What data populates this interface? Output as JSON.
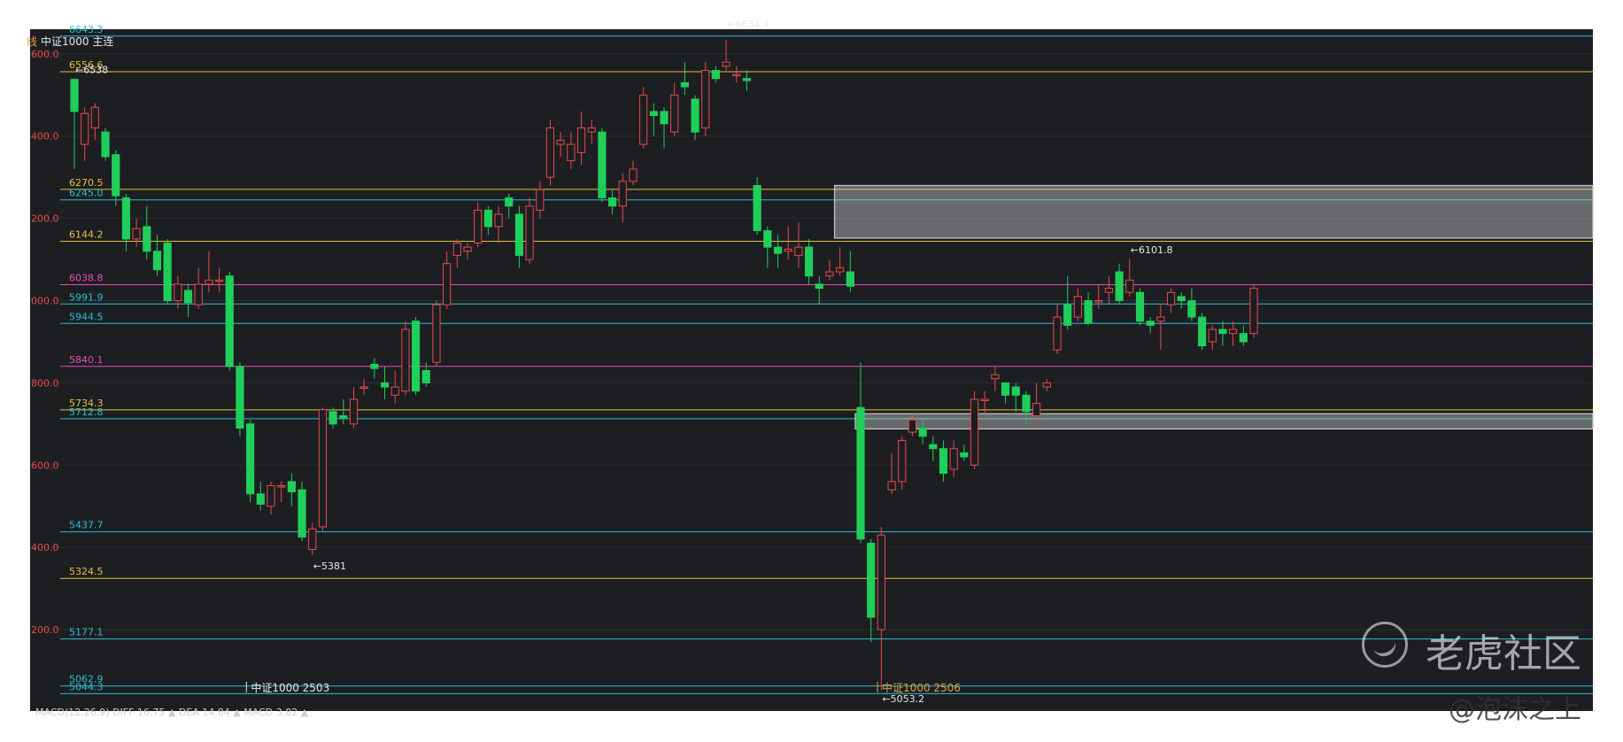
{
  "header": {
    "prefix": "线",
    "symbol": "中证1000 主连"
  },
  "y_ticks": [
    "600.0",
    "400.0",
    "200.0",
    "000.0",
    "800.0",
    "600.0",
    "400.0",
    "200.0"
  ],
  "levels": [
    {
      "value": 6643.3,
      "label": "6643.3",
      "color": "#2bc0cf"
    },
    {
      "value": 6556.6,
      "label": "6556.6",
      "color": "#e5c33b"
    },
    {
      "value": 6270.5,
      "label": "6270.5",
      "color": "#e5c33b"
    },
    {
      "value": 6245.0,
      "label": "6245.0",
      "color": "#2bc0cf"
    },
    {
      "value": 6144.2,
      "label": "6144.2",
      "color": "#e5c33b"
    },
    {
      "value": 6038.8,
      "label": "6038.8",
      "color": "#e54fb8"
    },
    {
      "value": 5991.9,
      "label": "5991.9",
      "color": "#2bc0cf"
    },
    {
      "value": 5944.5,
      "label": "5944.5",
      "color": "#2bc0cf"
    },
    {
      "value": 5840.1,
      "label": "5840.1",
      "color": "#e54fb8"
    },
    {
      "value": 5734.3,
      "label": "5734.3",
      "color": "#e5c33b"
    },
    {
      "value": 5712.8,
      "label": "5712.8",
      "color": "#2bc0cf"
    },
    {
      "value": 5437.7,
      "label": "5437.7",
      "color": "#2bc0cf"
    },
    {
      "value": 5324.5,
      "label": "5324.5",
      "color": "#e5c33b"
    },
    {
      "value": 5177.1,
      "label": "5177.1",
      "color": "#2bc0cf"
    },
    {
      "value": 5062.9,
      "label": "5062.9",
      "color": "#2bc0cf"
    },
    {
      "value": 5044.3,
      "label": "5044.3",
      "color": "#2bc0cf"
    }
  ],
  "annotations": [
    {
      "label": "←6538"
    },
    {
      "label": "←6634.4"
    },
    {
      "label": "←5381"
    },
    {
      "label": "←6101.8"
    },
    {
      "label": "←5053.2"
    }
  ],
  "contracts": [
    {
      "label": "中证1000 2503",
      "color": "#e8e8e8"
    },
    {
      "label": "中证1000 2506",
      "color": "#e5a13b"
    }
  ],
  "macd_text": "MACD(12,26,9)  DIFF 16.75 ▲ DEA 14.84 ▲ MACD 3.82 ▲",
  "watermark": {
    "brand": "老虎社区",
    "user": "@泡沫之上"
  },
  "colors": {
    "background": "#1d1e22",
    "up": "#e84a4a",
    "down": "#1fcf5a",
    "box": "#c9c9c9"
  },
  "chart_data": {
    "type": "candlestick",
    "ylim": [
      5030,
      6660
    ],
    "candles": [
      [
        6538,
        6460,
        6540,
        6320
      ],
      [
        6380,
        6455,
        6470,
        6340
      ],
      [
        6420,
        6470,
        6480,
        6390
      ],
      [
        6410,
        6350,
        6420,
        6340
      ],
      [
        6355,
        6255,
        6365,
        6230
      ],
      [
        6250,
        6150,
        6260,
        6120
      ],
      [
        6150,
        6175,
        6200,
        6130
      ],
      [
        6180,
        6120,
        6230,
        6100
      ],
      [
        6120,
        6075,
        6160,
        6060
      ],
      [
        6140,
        6000,
        6150,
        5990
      ],
      [
        6000,
        6040,
        6060,
        5980
      ],
      [
        6025,
        5995,
        6040,
        5960
      ],
      [
        5990,
        6040,
        6080,
        5980
      ],
      [
        6040,
        6050,
        6120,
        6020
      ],
      [
        6050,
        6050,
        6080,
        6020
      ],
      [
        6060,
        5840,
        6070,
        5830
      ],
      [
        5840,
        5690,
        5850,
        5670
      ],
      [
        5700,
        5530,
        5710,
        5510
      ],
      [
        5530,
        5505,
        5560,
        5490
      ],
      [
        5500,
        5550,
        5560,
        5480
      ],
      [
        5550,
        5550,
        5560,
        5510
      ],
      [
        5560,
        5535,
        5580,
        5500
      ],
      [
        5540,
        5425,
        5560,
        5415
      ],
      [
        5395,
        5445,
        5460,
        5381
      ],
      [
        5450,
        5735,
        5740,
        5440
      ],
      [
        5730,
        5700,
        5740,
        5690
      ],
      [
        5720,
        5715,
        5760,
        5700
      ],
      [
        5700,
        5760,
        5790,
        5690
      ],
      [
        5790,
        5790,
        5810,
        5770
      ],
      [
        5845,
        5835,
        5860,
        5810
      ],
      [
        5800,
        5790,
        5840,
        5760
      ],
      [
        5770,
        5790,
        5830,
        5750
      ],
      [
        5780,
        5930,
        5950,
        5770
      ],
      [
        5950,
        5780,
        5960,
        5770
      ],
      [
        5830,
        5800,
        5850,
        5790
      ],
      [
        5850,
        5990,
        6000,
        5840
      ],
      [
        5990,
        6090,
        6120,
        5980
      ],
      [
        6110,
        6140,
        6150,
        6080
      ],
      [
        6120,
        6130,
        6140,
        6100
      ],
      [
        6140,
        6220,
        6240,
        6130
      ],
      [
        6220,
        6180,
        6230,
        6160
      ],
      [
        6180,
        6210,
        6230,
        6140
      ],
      [
        6250,
        6230,
        6260,
        6200
      ],
      [
        6210,
        6110,
        6230,
        6080
      ],
      [
        6100,
        6230,
        6250,
        6090
      ],
      [
        6220,
        6270,
        6290,
        6200
      ],
      [
        6300,
        6420,
        6440,
        6280
      ],
      [
        6380,
        6390,
        6410,
        6350
      ],
      [
        6340,
        6380,
        6410,
        6320
      ],
      [
        6360,
        6420,
        6460,
        6330
      ],
      [
        6410,
        6420,
        6440,
        6380
      ],
      [
        6410,
        6250,
        6420,
        6240
      ],
      [
        6250,
        6230,
        6270,
        6210
      ],
      [
        6230,
        6290,
        6310,
        6190
      ],
      [
        6290,
        6320,
        6340,
        6280
      ],
      [
        6380,
        6500,
        6520,
        6370
      ],
      [
        6460,
        6450,
        6480,
        6400
      ],
      [
        6460,
        6430,
        6470,
        6370
      ],
      [
        6410,
        6500,
        6530,
        6400
      ],
      [
        6530,
        6520,
        6580,
        6500
      ],
      [
        6490,
        6410,
        6500,
        6390
      ],
      [
        6420,
        6560,
        6580,
        6400
      ],
      [
        6560,
        6540,
        6570,
        6530
      ],
      [
        6570,
        6580,
        6634.4,
        6560
      ],
      [
        6550,
        6550,
        6570,
        6530
      ],
      [
        6540,
        6535,
        6560,
        6510
      ],
      [
        6280,
        6170,
        6300,
        6160
      ],
      [
        6170,
        6130,
        6180,
        6080
      ],
      [
        6130,
        6115,
        6160,
        6080
      ],
      [
        6120,
        6125,
        6180,
        6100
      ],
      [
        6110,
        6130,
        6190,
        6080
      ],
      [
        6130,
        6060,
        6150,
        6040
      ],
      [
        6040,
        6030,
        6060,
        5990
      ],
      [
        6060,
        6070,
        6100,
        6050
      ],
      [
        6070,
        6080,
        6130,
        6060
      ],
      [
        6070,
        6035,
        6120,
        6020
      ],
      [
        5740,
        5420,
        5850,
        5410
      ],
      [
        5410,
        5230,
        5420,
        5170
      ],
      [
        5200,
        5430,
        5450,
        5053.2
      ],
      [
        5540,
        5560,
        5630,
        5530
      ],
      [
        5560,
        5660,
        5670,
        5540
      ],
      [
        5680,
        5710,
        5720,
        5670
      ],
      [
        5690,
        5670,
        5710,
        5650
      ],
      [
        5650,
        5640,
        5670,
        5610
      ],
      [
        5640,
        5580,
        5660,
        5560
      ],
      [
        5590,
        5640,
        5660,
        5570
      ],
      [
        5630,
        5620,
        5650,
        5610
      ],
      [
        5600,
        5760,
        5780,
        5590
      ],
      [
        5760,
        5760,
        5780,
        5720
      ],
      [
        5810,
        5820,
        5840,
        5780
      ],
      [
        5800,
        5770,
        5800,
        5750
      ],
      [
        5790,
        5770,
        5800,
        5730
      ],
      [
        5770,
        5730,
        5780,
        5700
      ],
      [
        5720,
        5750,
        5800,
        5710
      ],
      [
        5790,
        5800,
        5810,
        5780
      ],
      [
        5880,
        5960,
        5990,
        5870
      ],
      [
        5990,
        5940,
        6060,
        5930
      ],
      [
        5960,
        6010,
        6030,
        5950
      ],
      [
        6000,
        5945,
        6020,
        5940
      ],
      [
        6000,
        6000,
        6040,
        5980
      ],
      [
        6020,
        6030,
        6060,
        5990
      ],
      [
        6070,
        6000,
        6090,
        5990
      ],
      [
        6020,
        6050,
        6101.8,
        6010
      ],
      [
        6020,
        5950,
        6030,
        5940
      ],
      [
        5950,
        5940,
        5960,
        5920
      ],
      [
        5950,
        5960,
        5990,
        5880
      ],
      [
        5990,
        6020,
        6030,
        5970
      ],
      [
        6010,
        6000,
        6020,
        5980
      ],
      [
        6000,
        5960,
        6030,
        5950
      ],
      [
        5960,
        5890,
        5970,
        5880
      ],
      [
        5900,
        5930,
        5940,
        5880
      ],
      [
        5930,
        5920,
        5950,
        5890
      ],
      [
        5920,
        5930,
        5950,
        5890
      ],
      [
        5920,
        5900,
        5940,
        5890
      ],
      [
        5920,
        6030,
        6040,
        5910
      ]
    ],
    "zones": [
      {
        "y_top": 6280,
        "y_bottom": 6152,
        "x_start": 74,
        "x_end": 171
      },
      {
        "y_top": 5725,
        "y_bottom": 5688,
        "x_start": 76,
        "x_end": 175
      }
    ]
  }
}
